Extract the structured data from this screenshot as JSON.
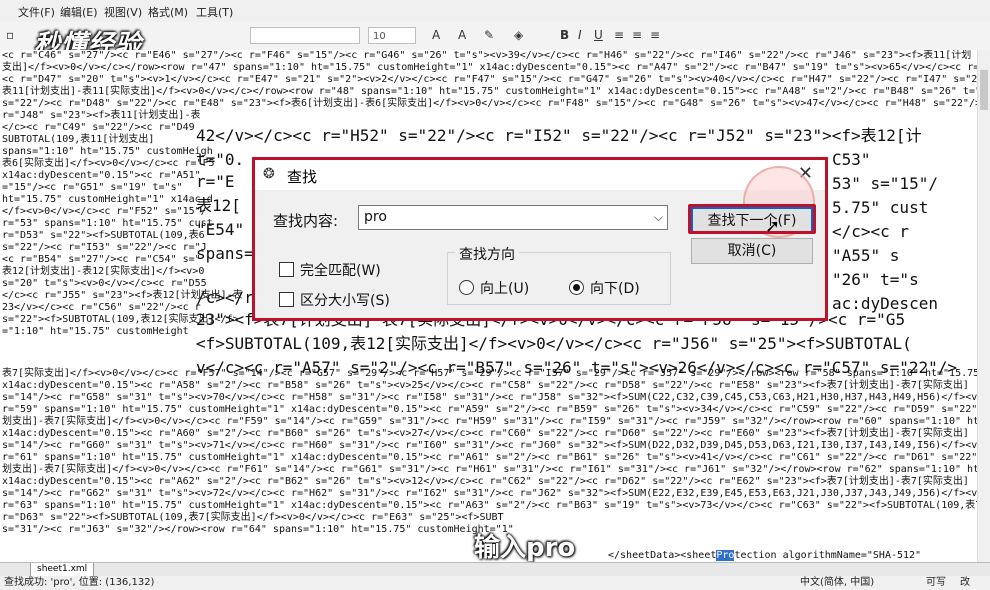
{
  "menu": [
    "文件(F)",
    "编辑(E)",
    "视图(V)",
    "格式(M)",
    "工具(T)"
  ],
  "toolbar": {
    "font_size": "10",
    "icons": [
      "bold-icon",
      "italic-icon",
      "underline-icon"
    ]
  },
  "watermark": "秒懂经验",
  "editor_lines": [
    "<c r=\"C46\" s=\"27\"/><c r=\"E46\" s=\"27\"/><c r=\"F46\" s=\"15\"/><c r=\"G46\" s=\"26\" t=\"s\"><v>39</v></c><c r=\"H46\" s=\"22\"/><c r=\"I46\" s=\"22\"/><c r=\"J46\" s=\"23\"><f>表11[计划",
    "支出]</f><v>0</v></c></row><row r=\"47\" spans=\"1:10\" ht=\"15.75\" customHeight=\"1\" x14ac:dyDescent=\"0.15\"><c r=\"A47\" s=\"2\"/><c r=\"B47\" s=\"19\" t=\"s\"><v>65</v></c><c r=\"C47\" s=\"20\" t",
    "<c r=\"D47\" s=\"20\" t=\"s\"><v>1</v></c><c r=\"E47\" s=\"21\" s=\"2\"><v>2</v></c><c r=\"F47\" s=\"15\"/><c r=\"G47\" s=\"26\" t=\"s\"><v>40</v></c><c r=\"H47\" s=\"22\"/><c r=\"I47\" s=\"22\"/><c r=\"J4",
    "表11[计划支出]-表11[实际支出]</f><v>0</v></c></row><row r=\"48\" spans=\"1:10\" ht=\"15.75\" customHeight=\"1\" x14ac:dyDescent=\"0.15\"><c r=\"A48\" s=\"2\"/><c r=\"B48\" s=\"26\" t=\"s\"><v>21</v>",
    "s=\"22\"/><c r=\"D48\" s=\"22\"/><c r=\"E48\" s=\"23\"><f>表6[计划支出]-表6[实际支出]</f><v>0</v></c><c r=\"F48\" s=\"15\"/><c r=\"G48\" s=\"26\" t=\"s\"><v>47</v></c><c r=\"H48\" s=\"22\"/><c",
    "r=\"J48\" s=\"23\"><f>表11[计划支出]-表",
    "</c><c r=\"C49\" s=\"22\"/><c r=\"D49",
    "SUBTOTAL(109,表11[计划支出]",
    "spans=\"1:10\" ht=\"15.75\" customHeigh",
    "表6[实际支出]</f><v>0</v></c><c r=\"F5",
    "x14ac:dyDescent=\"0.15\"><c r=\"A51\"",
    "=\"15\"/><c r=\"G51\" s=\"19\" t=\"s\"",
    "ht=\"15.75\" customHeight=\"1\" x14ac:d",
    "</f><v>0</v></c><c r=\"F52\" s=\"15\"/",
    "r=\"53\" spans=\"1:10\" ht=\"15.75\" cust",
    "r=\"D53\" s=\"22\"><f>SUBTOTAL(109,表6",
    "s=\"22\"/><c r=\"I53\" s=\"22\"/><c r=\"J",
    "<c r=\"B54\" s=\"27\"/><c r=\"C54\" s=\"",
    "表12[计划支出]-表12[实际支出]</f><v>0",
    "s=\"20\" t=\"s\"><v>0</v></c><c r=\"D55",
    "</c><c r=\"J55\" s=\"23\"><f>表12[计划支出]-表",
    "23</v></c><c r=\"C56\" s=\"22\"/><c r",
    "s=\"22\"><f>SUBTOTAL(109,表12[实际支出]</f>",
    "=\"1:10\" ht=\"15.75\" customHeight",
    "表7[实际支出]</f><v>0</v></c><c r=\"F57\" s=\"14\"/><c r=\"G57\" s=\"29\"/><c r=\"H57\" s=\"29\"/><c r=\"I57\" s=\"29\"/><c r=\"J57\" s=\"29\"/></row><row r=\"58\" spans=\"1:10\" ht=\"15.75\"",
    "x14ac:dyDescent=\"0.15\"><c r=\"A58\" s=\"2\"/><c r=\"B58\" s=\"26\" t=\"s\"><v>25</v></c><c r=\"C58\" s=\"22\"/><c r=\"D58\" s=\"22\"/><c r=\"E58\" s=\"23\"><f>表7[计划支出]-表7[实际支出]",
    "s=\"14\"/><c r=\"G58\" s=\"31\" t=\"s\"><v>70</v></c><c r=\"H58\" s=\"31\"/><c r=\"I58\" s=\"31\"/><c r=\"J58\" s=\"32\"><f>SUM(C22,C32,C39,C45,C53,C63,H21,H30,H37,H43,H49,H56)</f><v>2060</v>",
    "r=\"59\" spans=\"1:10\" ht=\"15.75\" customHeight=\"1\" x14ac:dyDescent=\"0.15\"><c r=\"A59\" s=\"2\"/><c r=\"B59\" s=\"26\" t=\"s\"><v>34</v></c><c r=\"C59\" s=\"22\"/><c r=\"D59\" s=\"22\"/><c r=\"E59\"",
    "划支出]-表7[实际支出]</f><v>0</v></c><c r=\"F59\" s=\"14\"/><c r=\"G59\" s=\"31\"/><c r=\"H59\" s=\"31\"/><c r=\"I59\" s=\"31\"/><c r=\"J59\" s=\"32\"/></row><row r=\"60\" spans=\"1:10\" ht=\"15.75\" c",
    "x14ac:dyDescent=\"0.15\"><c r=\"A60\" s=\"2\"/><c r=\"B60\" s=\"26\" t=\"s\"><v>27</v></c><c r=\"C60\" s=\"22\"/><c r=\"D60\" s=\"22\"/><c r=\"E60\" s=\"23\"><f>表7[计划支出]-表7[实际支出]",
    "s=\"14\"/><c r=\"G60\" s=\"31\" t=\"s\"><v>71</v></c><c r=\"H60\" s=\"31\"/><c r=\"I60\" s=\"31\"/><c r=\"J60\" s=\"32\"><f>SUM(D22,D32,D39,D45,D53,D63,I21,I30,I37,I43,I49,I56)</f><v>2040</v>",
    "r=\"61\" spans=\"1:10\" ht=\"15.75\" customHeight=\"1\" x14ac:dyDescent=\"0.15\"><c r=\"A61\" s=\"2\"/><c r=\"B61\" s=\"26\" t=\"s\"><v>41</v></c><c r=\"C61\" s=\"22\"/><c r=\"D61\" s=\"22\"/><c r=\"E61\"",
    "划支出]-表7[实际支出]</f><v>0</v></c><c r=\"F61\" s=\"14\"/><c r=\"G61\" s=\"31\"/><c r=\"H61\" s=\"31\"/><c r=\"I61\" s=\"31\"/><c r=\"J61\" s=\"32\"/></row><row r=\"62\" spans=\"1:10\" ht=\"15.75\" c",
    "x14ac:dyDescent=\"0.15\"><c r=\"A62\" s=\"2\"/><c r=\"B62\" s=\"26\" t=\"s\"><v>12</v></c><c r=\"C62\" s=\"22\"/><c r=\"D62\" s=\"22\"/><c r=\"E62\" s=\"23\"><f>表7[计划支出]-表7[实际支出]",
    "s=\"14\"/><c r=\"G62\" s=\"31\" t=\"s\"><v>72</v></c><c r=\"H62\" s=\"31\"/><c r=\"I62\" s=\"31\"/><c r=\"J62\" s=\"32\"><f>SUM(E22,E32,E39,E45,E53,E63,J21,J30,J37,J43,J49,J56)</f><v>20</v>",
    "r=\"63\" spans=\"1:10\" ht=\"15.75\" customHeight=\"1\" x14ac:dyDescent=\"0.15\"><c r=\"A63\" s=\"2\"/><c r=\"B63\" s=\"19\" t=\"s\"><v>73</v></c><c r=\"C63\" s=\"22\"><f>SUBTOTAL(109,表7[计划支出]",
    "r=\"D63\" s=\"22\"><f>SUBTOTAL(109,表7[实际支出]</f><v>0</v></c><c r=\"E63\" s=\"25\"><f>SUBT",
    "s=\"31\"/><c r=\"J63\" s=\"32\"/></row><row r=\"64\" spans=\"1:10\" ht=\"15.75\" customHeight=\"1\""
  ],
  "big_lines": [
    "42</v></c><c r=\"H52\" s=\"22\"/><c r=\"I52\" s=\"22\"/><c r=\"J52\" s=\"23\"><f>表12[计",
    "t=\"0.",
    "r=\"E",
    "表12[",
    "\"E54\"",
    "spans=",
    "/c></r",
    "23\"><f>表7[计划支出]-表7[实际支出]</f><v>0</v></c><c r=\"F56\" s=\"15\"/><c r=\"G5",
    "<f>SUBTOTAL(109,表12[实际支出]</f><v>0</v></c><c r=\"J56\" s=\"25\"><f>SUBTOTAL(",
    "v</c><c r=\"A57\" s=\"2\"/><c r=\"B57\" s=\"26\" t=\"s\"><v>26</v></c><c r=\"C57\" s=\"22\"/>"
  ],
  "right_fragments": [
    "C53\"",
    "53\" s=\"15\"/",
    "5.75\" cust",
    "</c><c r",
    "\"A55\" s",
    "\"26\" t=\"s",
    "ac:dyDescen"
  ],
  "tail_text": {
    "before": "</sheetData><sheetPro",
    "highlight": "Pro",
    "after": "tection algorithmName=\"SHA-512\""
  },
  "caption": "输入pro",
  "tab": "sheet1.xml",
  "status": {
    "left": "查找成功: 'pro', 位置: (136,132)",
    "encoding": "中文(简体, 中国)",
    "mode1": "可写",
    "mode2": "改"
  },
  "dialog": {
    "title": "查找",
    "find_label": "查找内容:",
    "find_value": "pro",
    "find_next_button": "查找下一个(F)",
    "cancel_button": "取消(C)",
    "match_whole": "完全匹配(W)",
    "match_case": "区分大小写(S)",
    "direction_label": "查找方向",
    "dir_up": "向上(U)",
    "dir_down": "向下(D)",
    "direction_selected": "down",
    "highlight_color": "#c0102a"
  }
}
